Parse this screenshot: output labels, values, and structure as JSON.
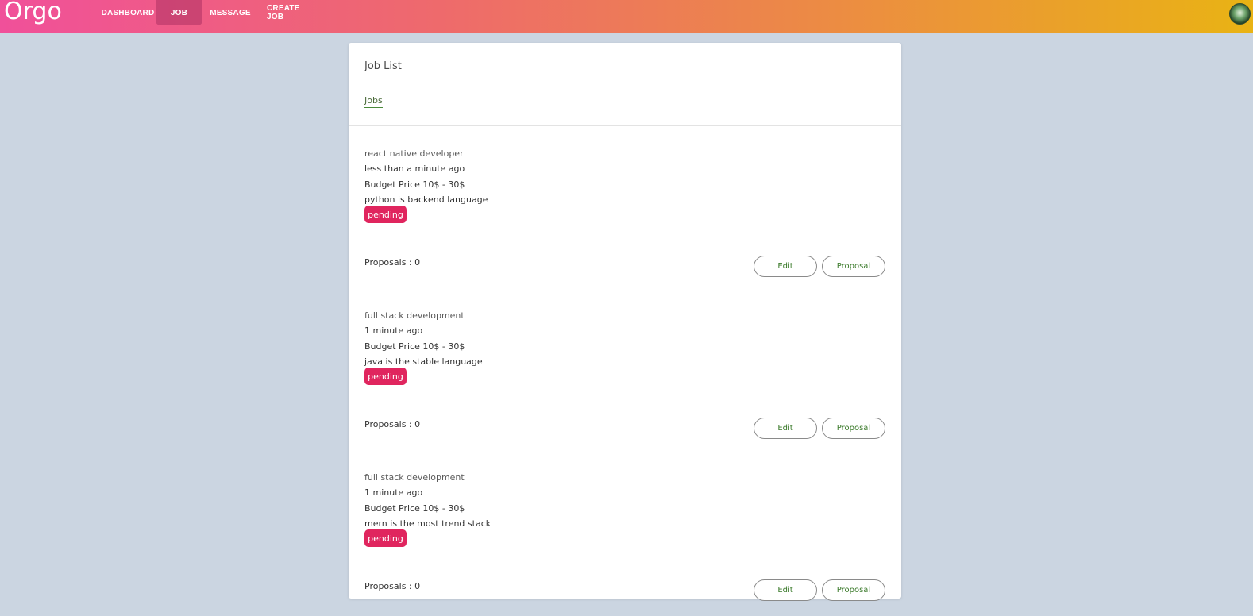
{
  "brand": "Orgo",
  "nav": {
    "dashboard": "DASHBOARD",
    "job": "JOB",
    "message": "MESSAGE",
    "create_job": "CREATE JOB"
  },
  "card": {
    "title": "Job List",
    "tab": "Jobs"
  },
  "jobs": [
    {
      "title": "react native developer",
      "time": "less than a minute ago",
      "budget": "Budget Price 10$ - 30$",
      "description": "python is backend language",
      "status": "pending",
      "proposals": "Proposals : 0",
      "edit_label": "Edit",
      "proposal_label": "Proposal"
    },
    {
      "title": "full stack development",
      "time": "1 minute ago",
      "budget": "Budget Price 10$ - 30$",
      "description": "java is the stable language",
      "status": "pending",
      "proposals": "Proposals : 0",
      "edit_label": "Edit",
      "proposal_label": "Proposal"
    },
    {
      "title": "full stack development",
      "time": "1 minute ago",
      "budget": "Budget Price 10$ - 30$",
      "description": "mern is the most trend stack",
      "status": "pending",
      "proposals": "Proposals : 0",
      "edit_label": "Edit",
      "proposal_label": "Proposal"
    }
  ],
  "colors": {
    "nav_gradient_start": "#f0509a",
    "nav_gradient_end": "#e9b314",
    "badge": "#e0255e",
    "button_text": "#3a7a2a",
    "background": "#cbd5e1"
  },
  "icons": {
    "avatar": "user-avatar-icon"
  }
}
